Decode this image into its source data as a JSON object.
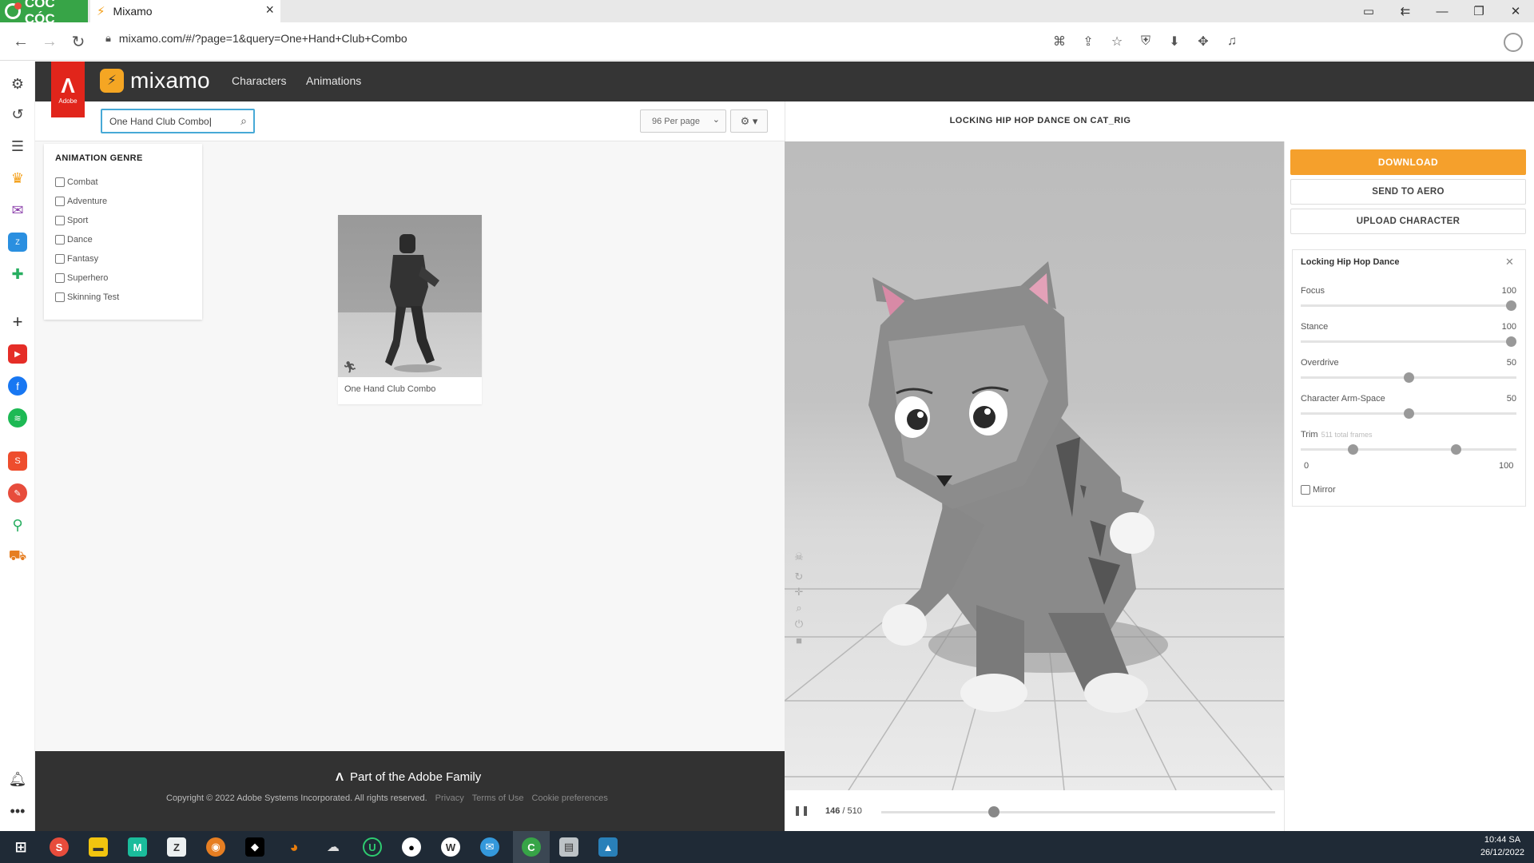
{
  "browser": {
    "brand": "CÓC CÓC",
    "tab_title": "Mixamo",
    "url": "mixamo.com/#/?page=1&query=One+Hand+Club+Combo"
  },
  "header": {
    "adobe_badge": "Adobe",
    "logo_text": "mixamo",
    "nav": [
      "Characters",
      "Animations"
    ]
  },
  "search": {
    "value": "One Hand Club Combo",
    "per_page": "96 Per page"
  },
  "genre_panel": {
    "title": "ANIMATION GENRE",
    "items": [
      "Combat",
      "Adventure",
      "Sport",
      "Dance",
      "Fantasy",
      "Superhero",
      "Skinning Test"
    ]
  },
  "results": [
    {
      "label": "One Hand Club Combo"
    }
  ],
  "footer": {
    "brand": "Part of the Adobe Family",
    "copyright": "Copyright © 2022 Adobe Systems Incorporated. All rights reserved.",
    "links": [
      "Privacy",
      "Terms of Use",
      "Cookie preferences"
    ]
  },
  "viewer": {
    "title": "LOCKING HIP HOP DANCE ON CAT_RIG",
    "current_frame": "146",
    "total_frames": "510",
    "frame_progress": 0.286
  },
  "actions": {
    "download": "DOWNLOAD",
    "send_to_aero": "SEND TO AERO",
    "upload_character": "UPLOAD CHARACTER"
  },
  "anim_settings": {
    "name": "Locking Hip Hop Dance",
    "focus_label": "Focus",
    "focus_value": "100",
    "stance_label": "Stance",
    "stance_value": "100",
    "overdrive_label": "Overdrive",
    "overdrive_value": "50",
    "armspace_label": "Character Arm-Space",
    "armspace_value": "50",
    "trim_label": "Trim",
    "trim_hint": "511 total frames",
    "trim_min": "0",
    "trim_max": "100",
    "trim_start": 0.24,
    "trim_end": 0.72,
    "mirror_label": "Mirror"
  },
  "taskbar": {
    "time": "10:44 SA",
    "date": "26/12/2022"
  },
  "colors": {
    "accent_orange": "#f5a02c",
    "adobe_red": "#e1251b",
    "header_dark": "#353535",
    "search_focus": "#47a9d6"
  }
}
